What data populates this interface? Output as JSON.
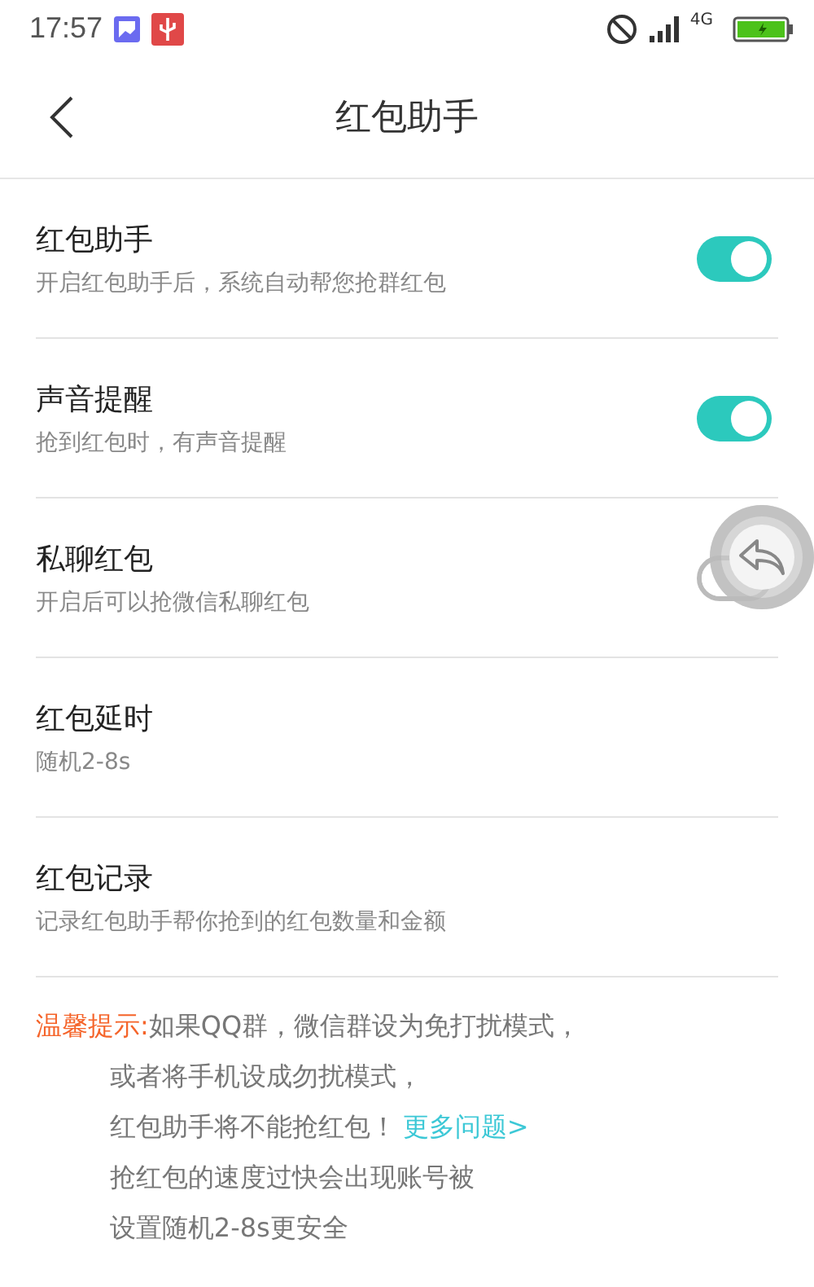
{
  "status_bar": {
    "time": "17:57",
    "network": "4G"
  },
  "header": {
    "title": "红包助手"
  },
  "settings": [
    {
      "kind": "toggle",
      "title": "红包助手",
      "subtitle": "开启红包助手后，系统自动帮您抢群红包",
      "on": true
    },
    {
      "kind": "toggle",
      "title": "声音提醒",
      "subtitle": "抢到红包时，有声音提醒",
      "on": true
    },
    {
      "kind": "toggle",
      "title": "私聊红包",
      "subtitle": "开启后可以抢微信私聊红包",
      "on": false
    },
    {
      "kind": "link",
      "title": "红包延时",
      "subtitle": "随机2-8s"
    },
    {
      "kind": "link",
      "title": "红包记录",
      "subtitle": "记录红包助手帮你抢到的红包数量和金额"
    }
  ],
  "tip": {
    "label": "温馨提示:",
    "lines": [
      {
        "text": "如果QQ群，微信群设为免打扰模式，"
      },
      {
        "text": "或者将手机设成勿扰模式，"
      },
      {
        "text": "红包助手将不能抢红包！",
        "link": "更多问题>"
      },
      {
        "text": "抢红包的速度过快会出现账号被"
      },
      {
        "text": "设置随机2-8s更安全"
      }
    ]
  }
}
